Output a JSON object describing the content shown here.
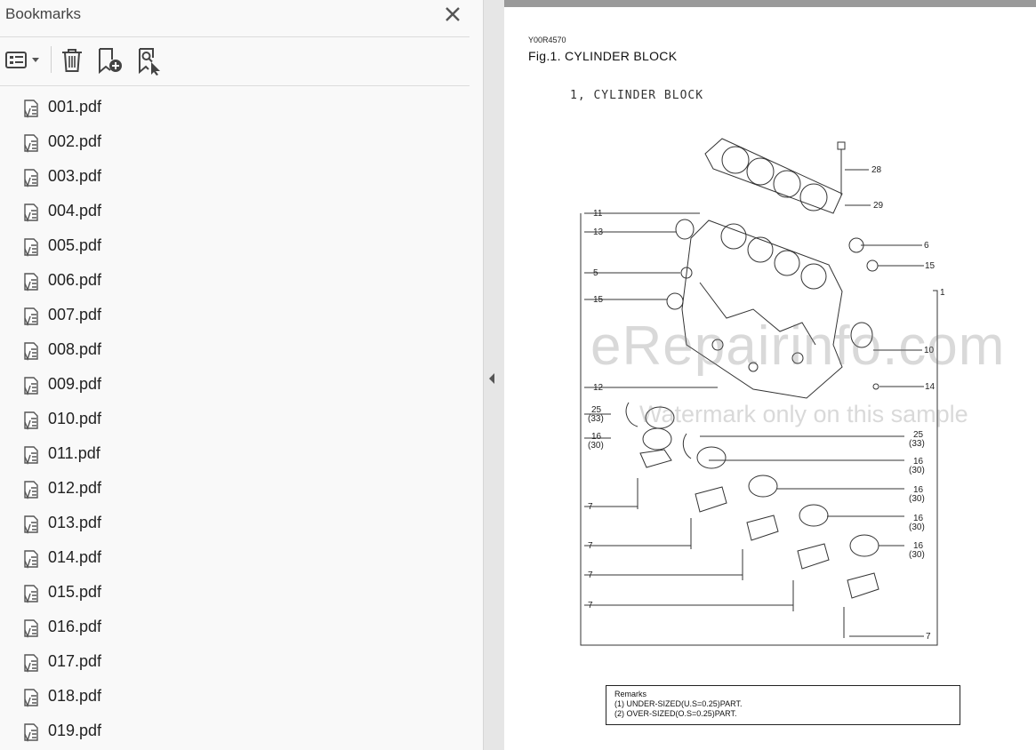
{
  "sidebar": {
    "title": "Bookmarks",
    "icons": {
      "close": "close-icon",
      "options": "options-menu-icon",
      "delete": "trash-icon",
      "new_bookmark": "add-bookmark-icon",
      "bookmark_search": "find-bookmark-icon"
    },
    "items": [
      {
        "label": "001.pdf"
      },
      {
        "label": "002.pdf"
      },
      {
        "label": "003.pdf"
      },
      {
        "label": "004.pdf"
      },
      {
        "label": "005.pdf"
      },
      {
        "label": "006.pdf"
      },
      {
        "label": "007.pdf"
      },
      {
        "label": "008.pdf"
      },
      {
        "label": "009.pdf"
      },
      {
        "label": "010.pdf"
      },
      {
        "label": "011.pdf"
      },
      {
        "label": "012.pdf"
      },
      {
        "label": "013.pdf"
      },
      {
        "label": "014.pdf"
      },
      {
        "label": "015.pdf"
      },
      {
        "label": "016.pdf"
      },
      {
        "label": "017.pdf"
      },
      {
        "label": "018.pdf"
      },
      {
        "label": "019.pdf"
      }
    ]
  },
  "document": {
    "code": "Y00R4570",
    "figure_title": "Fig.1.  CYLINDER BLOCK",
    "subtitle": "1, CYLINDER BLOCK",
    "callouts": [
      "28",
      "29",
      "11",
      "13",
      "6",
      "15",
      "1",
      "5",
      "15",
      "10",
      "12",
      "14",
      "25",
      "(33)",
      "16",
      "(30)",
      "25",
      "(33)",
      "16",
      "(30)",
      "16",
      "(30)",
      "16",
      "(30)",
      "16",
      "(30)",
      "7",
      "7",
      "7",
      "7",
      "7"
    ],
    "remarks": {
      "heading": "Remarks",
      "line1": "(1) UNDER-SIZED(U.S=0.25)PART.",
      "line2": "(2) OVER-SIZED(O.S=0.25)PART."
    },
    "watermark_main": "eRepairinfo.com",
    "watermark_sub": "Watermark only on this sample"
  }
}
